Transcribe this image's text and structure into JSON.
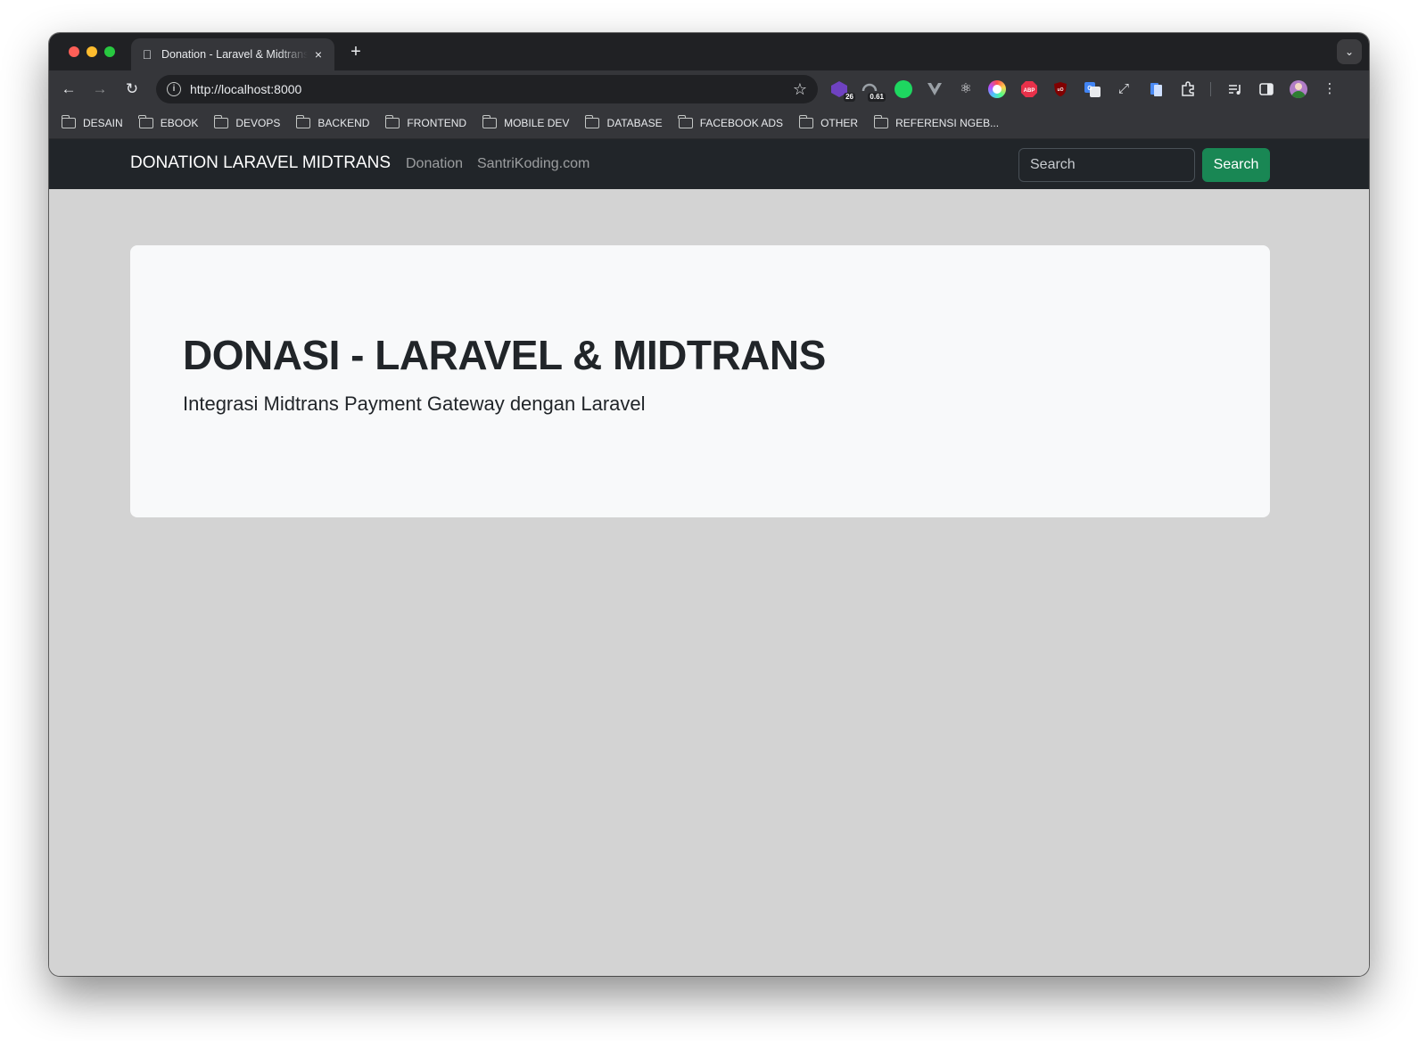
{
  "browser": {
    "tab_title": "Donation - Laravel & Midtrans",
    "tab_close": "×",
    "new_tab": "+",
    "url": "http://localhost:8000",
    "extension_badges": {
      "ext1": "26",
      "ext2": "0.61"
    },
    "bookmarks": [
      "DESAIN",
      "EBOOK",
      "DEVOPS",
      "BACKEND",
      "FRONTEND",
      "MOBILE DEV",
      "DATABASE",
      "FACEBOOK ADS",
      "OTHER",
      "REFERENSI NGEB..."
    ]
  },
  "navbar": {
    "brand": "DONATION LARAVEL MIDTRANS",
    "links": [
      "Donation",
      "SantriKoding.com"
    ],
    "search_placeholder": "Search",
    "search_button": "Search"
  },
  "jumbotron": {
    "title": "DONASI - LARAVEL & MIDTRANS",
    "subtitle": "Integrasi Midtrans Payment Gateway dengan Laravel"
  },
  "colors": {
    "navbar_bg": "#212529",
    "search_button_bg": "#198754",
    "page_bg": "#d3d3d3",
    "jumbotron_bg": "#f8f9fa"
  }
}
